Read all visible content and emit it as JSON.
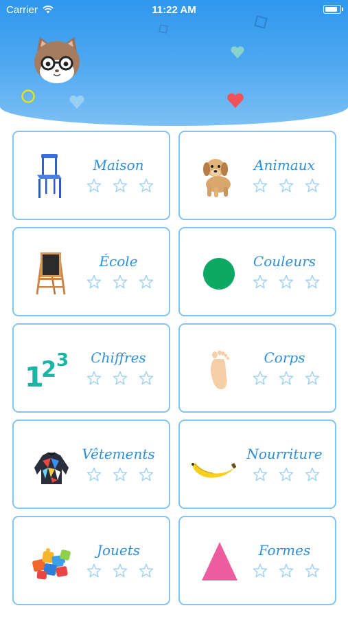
{
  "status_bar": {
    "carrier": "Carrier",
    "time": "11:22 AM"
  },
  "colors": {
    "header": "#3a9ff0",
    "card_border": "#7ec5f0",
    "label": "#2e8fdb",
    "star_outline": "#9fd2f5"
  },
  "categories": [
    {
      "label": "Maison",
      "icon": "chair-icon",
      "stars_filled": 0,
      "stars_total": 3
    },
    {
      "label": "Animaux",
      "icon": "puppy-icon",
      "stars_filled": 0,
      "stars_total": 3
    },
    {
      "label": "École",
      "icon": "chalkboard-icon",
      "stars_filled": 0,
      "stars_total": 3
    },
    {
      "label": "Couleurs",
      "icon": "green-circle-icon",
      "stars_filled": 0,
      "stars_total": 3
    },
    {
      "label": "Chiffres",
      "icon": "numbers-icon",
      "stars_filled": 0,
      "stars_total": 3
    },
    {
      "label": "Corps",
      "icon": "foot-icon",
      "stars_filled": 0,
      "stars_total": 3
    },
    {
      "label": "Vêtements",
      "icon": "sweater-icon",
      "stars_filled": 0,
      "stars_total": 3
    },
    {
      "label": "Nourriture",
      "icon": "banana-icon",
      "stars_filled": 0,
      "stars_total": 3
    },
    {
      "label": "Jouets",
      "icon": "puzzle-icon",
      "stars_filled": 0,
      "stars_total": 3
    },
    {
      "label": "Formes",
      "icon": "triangle-icon",
      "stars_filled": 0,
      "stars_total": 3
    }
  ],
  "numbers_icon_text": {
    "one": "1",
    "two": "2",
    "three": "3"
  }
}
